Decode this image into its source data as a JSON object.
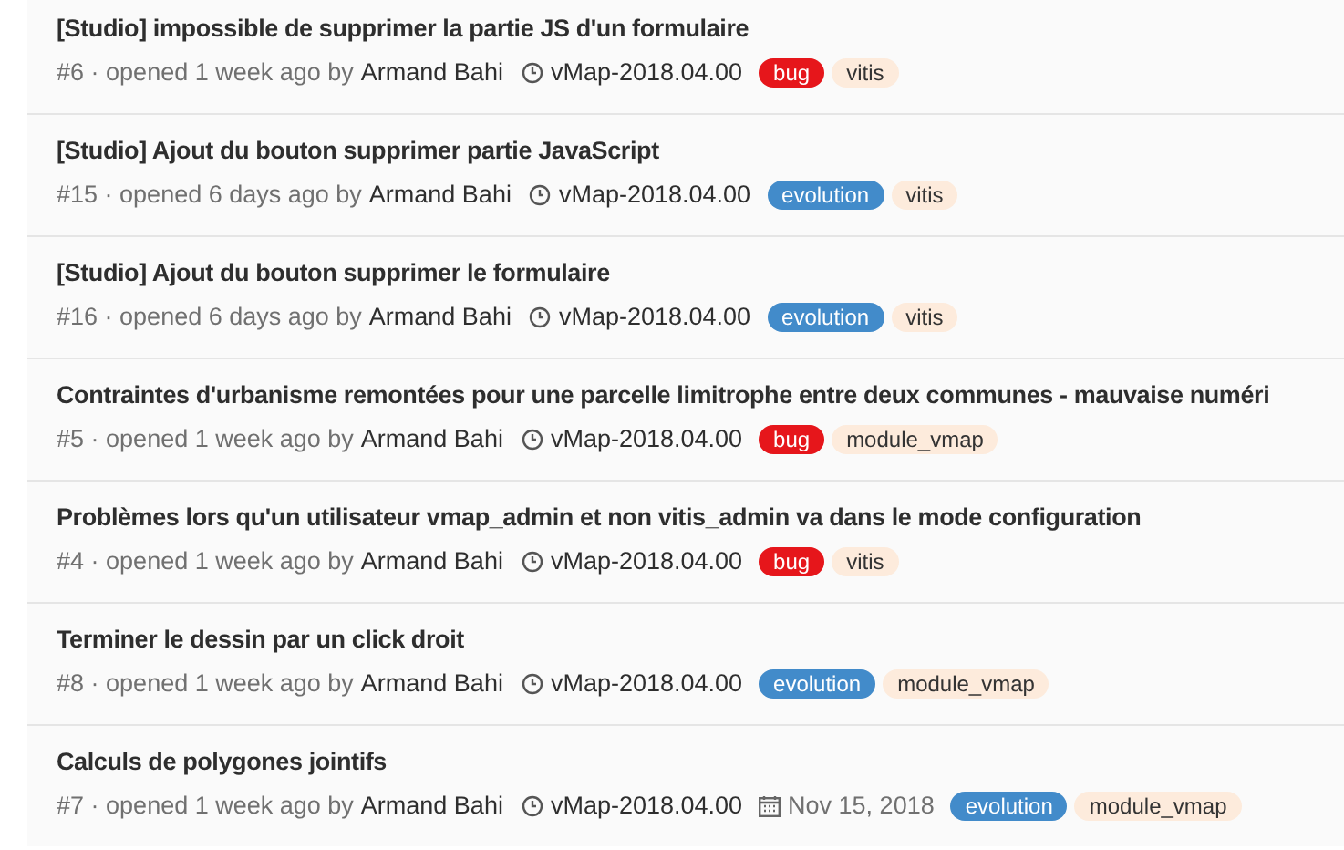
{
  "issues": [
    {
      "title": "[Studio] impossible de supprimer la partie JS d'un formulaire",
      "ref": "#6",
      "opened": "· opened 1 week ago by",
      "author": "Armand Bahi",
      "milestone": "vMap-2018.04.00",
      "labels": [
        {
          "text": "bug",
          "color": "#e6161b"
        },
        {
          "text": "vitis",
          "color": "#fdebdc"
        }
      ]
    },
    {
      "title": "[Studio] Ajout du bouton supprimer partie JavaScript",
      "ref": "#15",
      "opened": "· opened 6 days ago by",
      "author": "Armand Bahi",
      "milestone": "vMap-2018.04.00",
      "labels": [
        {
          "text": "evolution",
          "color": "#428bca"
        },
        {
          "text": "vitis",
          "color": "#fdebdc"
        }
      ]
    },
    {
      "title": "[Studio] Ajout du bouton supprimer le formulaire",
      "ref": "#16",
      "opened": "· opened 6 days ago by",
      "author": "Armand Bahi",
      "milestone": "vMap-2018.04.00",
      "labels": [
        {
          "text": "evolution",
          "color": "#428bca"
        },
        {
          "text": "vitis",
          "color": "#fdebdc"
        }
      ]
    },
    {
      "title": "Contraintes d'urbanisme remontées pour une parcelle limitrophe entre deux communes - mauvaise numéri",
      "ref": "#5",
      "opened": "· opened 1 week ago by",
      "author": "Armand Bahi",
      "milestone": "vMap-2018.04.00",
      "labels": [
        {
          "text": "bug",
          "color": "#e6161b"
        },
        {
          "text": "module_vmap",
          "color": "#fdebdc"
        }
      ]
    },
    {
      "title": "Problèmes lors qu'un utilisateur vmap_admin et non vitis_admin va dans le mode configuration",
      "ref": "#4",
      "opened": "· opened 1 week ago by",
      "author": "Armand Bahi",
      "milestone": "vMap-2018.04.00",
      "labels": [
        {
          "text": "bug",
          "color": "#e6161b"
        },
        {
          "text": "vitis",
          "color": "#fdebdc"
        }
      ]
    },
    {
      "title": "Terminer le dessin par un click droit",
      "ref": "#8",
      "opened": "· opened 1 week ago by",
      "author": "Armand Bahi",
      "milestone": "vMap-2018.04.00",
      "labels": [
        {
          "text": "evolution",
          "color": "#428bca"
        },
        {
          "text": "module_vmap",
          "color": "#fdebdc"
        }
      ]
    },
    {
      "title": "Calculs de polygones jointifs",
      "ref": "#7",
      "opened": "· opened 1 week ago by",
      "author": "Armand Bahi",
      "milestone": "vMap-2018.04.00",
      "due": "Nov 15, 2018",
      "labels": [
        {
          "text": "evolution",
          "color": "#428bca"
        },
        {
          "text": "module_vmap",
          "color": "#fdebdc"
        }
      ]
    }
  ]
}
